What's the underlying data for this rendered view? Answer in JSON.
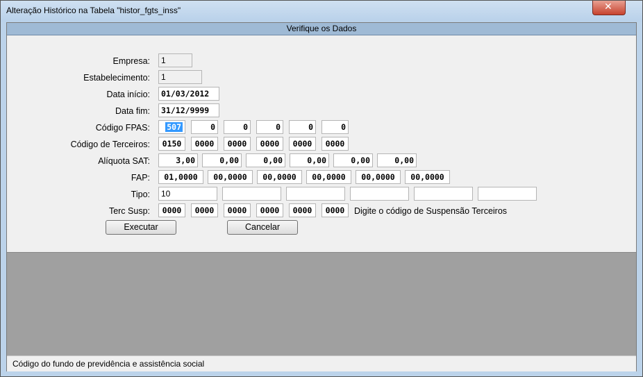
{
  "window": {
    "title": "Alteração Histórico na Tabela \"histor_fgts_inss\"",
    "close_glyph": "✕"
  },
  "header": {
    "title": "Verifique os Dados"
  },
  "form": {
    "empresa": {
      "label": "Empresa:",
      "value": "1"
    },
    "estabelecimento": {
      "label": "Estabelecimento:",
      "value": "1"
    },
    "data_inicio": {
      "label": "Data início:",
      "value": "01/03/2012"
    },
    "data_fim": {
      "label": "Data fim:",
      "value": "31/12/9999"
    },
    "codigo_fpas": {
      "label": "Código FPAS:",
      "values": [
        "507",
        "0",
        "0",
        "0",
        "0",
        "0"
      ]
    },
    "codigo_terceiros": {
      "label": "Código de Terceiros:",
      "values": [
        "0150",
        "0000",
        "0000",
        "0000",
        "0000",
        "0000"
      ]
    },
    "aliquota_sat": {
      "label": "Alíquota SAT:",
      "values": [
        "3,00",
        "0,00",
        "0,00",
        "0,00",
        "0,00",
        "0,00"
      ]
    },
    "fap": {
      "label": "FAP:",
      "values": [
        "01,0000",
        "00,0000",
        "00,0000",
        "00,0000",
        "00,0000",
        "00,0000"
      ]
    },
    "tipo": {
      "label": "Tipo:",
      "values": [
        "10",
        "",
        "",
        "",
        "",
        ""
      ]
    },
    "terc_susp": {
      "label": "Terc Susp:",
      "values": [
        "0000",
        "0000",
        "0000",
        "0000",
        "0000",
        "0000"
      ],
      "hint": "Digite o código de Suspensão Terceiros"
    }
  },
  "buttons": {
    "executar": "Executar",
    "cancelar": "Cancelar"
  },
  "status": {
    "text": "Código do fundo de previdência e assistência social"
  }
}
